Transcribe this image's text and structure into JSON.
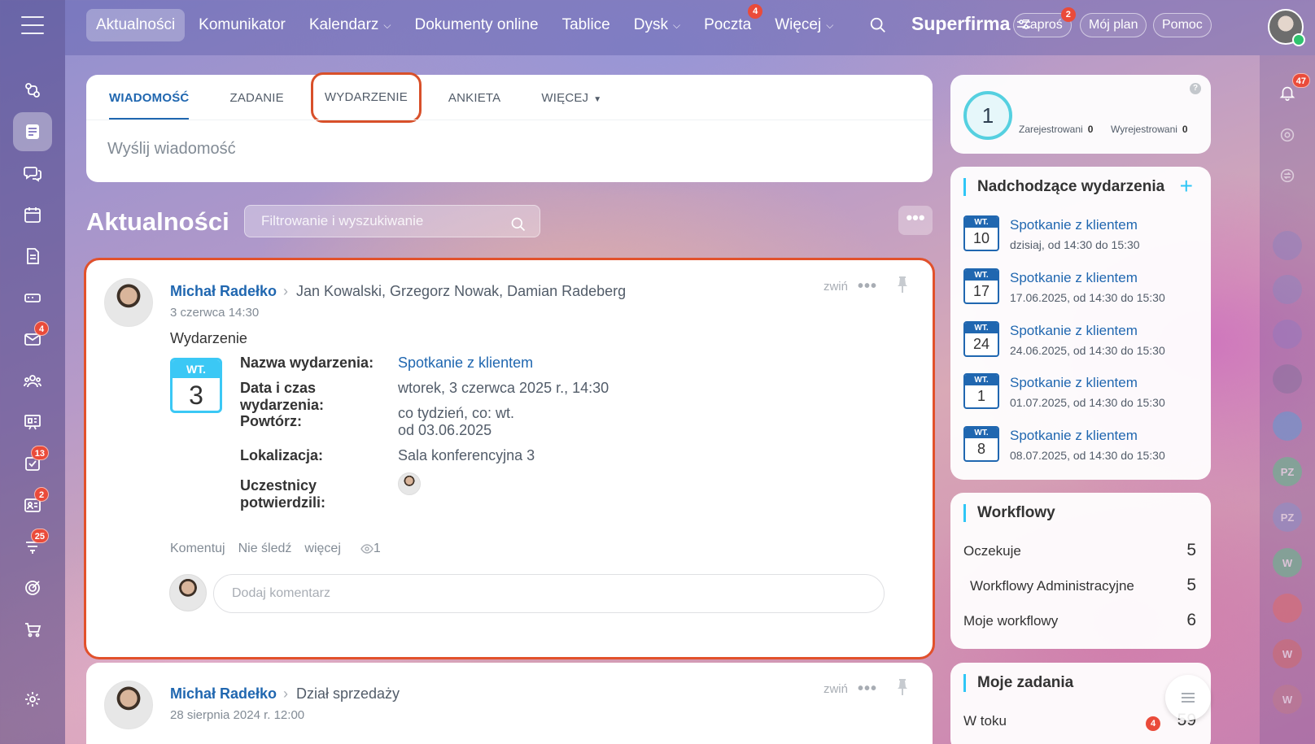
{
  "topnav": {
    "items": [
      {
        "label": "Aktualności",
        "active": true
      },
      {
        "label": "Komunikator"
      },
      {
        "label": "Kalendarz",
        "caret": "⌵"
      },
      {
        "label": "Dokumenty online"
      },
      {
        "label": "Tablice"
      },
      {
        "label": "Dysk",
        "caret": "⌵"
      },
      {
        "label": "Poczta",
        "badge": "4"
      },
      {
        "label": "Więcej",
        "caret": "⌵"
      }
    ],
    "brand": "Superfirma",
    "invite": {
      "label": "Zaproś",
      "badge": "2"
    },
    "plan": "Mój plan",
    "help": "Pomoc"
  },
  "sidebar": {
    "badges": {
      "mail": "4",
      "tasks": "13",
      "crm": "2",
      "feed": "25"
    }
  },
  "rail": {
    "notifications_badge": "47",
    "initials": [
      "PZ",
      "PZ",
      "W",
      "W",
      "W"
    ]
  },
  "composer": {
    "tabs": [
      "Wiadomość",
      "Zadanie",
      "Wydarzenie",
      "Ankieta",
      "Więcej"
    ],
    "placeholder": "Wyślij wiadomość"
  },
  "feed": {
    "title": "Aktualności",
    "filter_placeholder": "Filtrowanie i wyszukiwanie",
    "more": "•••"
  },
  "post": {
    "author": "Michał Radełko",
    "recipients": "Jan Kowalski, Grzegorz Nowak, Damian Radeberg",
    "date": "3 czerwca 14:30",
    "collapse": "zwiń",
    "dots": "•••",
    "type": "Wydarzenie",
    "calendar": {
      "day": "WT.",
      "num": "3"
    },
    "fields": {
      "name_label": "Nazwa wydarzenia:",
      "name_value": "Spotkanie z klientem",
      "datetime_label": "Data i czas wydarzenia:",
      "datetime_value": "wtorek, 3 czerwca 2025 r., 14:30",
      "repeat_label": "Powtórz:",
      "repeat_value_1": "co tydzień, co: wt.",
      "repeat_value_2": "od 03.06.2025",
      "location_label": "Lokalizacja:",
      "location_value": "Sala konferencyjna 3",
      "confirmed_label": "Uczestnicy potwierdzili:"
    },
    "footer": {
      "comment": "Komentuj",
      "unfollow": "Nie śledź",
      "more": "więcej",
      "views": "1"
    },
    "comment_placeholder": "Dodaj komentarz"
  },
  "post2": {
    "author": "Michał Radełko",
    "recipients": "Dział sprzedaży",
    "date": "28 sierpnia 2024 r. 12:00",
    "collapse": "zwiń",
    "dots": "•••"
  },
  "stats_widget": {
    "count": "1",
    "registered_label": "Zarejestrowani",
    "registered_value": "0",
    "unregistered_label": "Wyrejestrowani",
    "unregistered_value": "0",
    "help": "?"
  },
  "upcoming": {
    "title": "Nadchodzące wydarzenia",
    "plus": "+",
    "events": [
      {
        "day": "WT.",
        "num": "10",
        "title": "Spotkanie z klientem",
        "time": "dzisiaj, od 14:30 do 15:30"
      },
      {
        "day": "WT.",
        "num": "17",
        "title": "Spotkanie z klientem",
        "time": "17.06.2025, od 14:30 do 15:30"
      },
      {
        "day": "WT.",
        "num": "24",
        "title": "Spotkanie z klientem",
        "time": "24.06.2025, od 14:30 do 15:30"
      },
      {
        "day": "WT.",
        "num": "1",
        "title": "Spotkanie z klientem",
        "time": "01.07.2025, od 14:30 do 15:30"
      },
      {
        "day": "WT.",
        "num": "8",
        "title": "Spotkanie z klientem",
        "time": "08.07.2025, od 14:30 do 15:30"
      }
    ]
  },
  "workflows": {
    "title": "Workflowy",
    "rows": [
      {
        "label": "Oczekuje",
        "value": "5"
      },
      {
        "label": "Workflowy Administracyjne",
        "value": "5"
      },
      {
        "label": "Moje workflowy",
        "value": "6"
      }
    ]
  },
  "my_tasks": {
    "title": "Moje zadania",
    "row_label": "W toku",
    "row_badge": "4",
    "row_value": "59"
  }
}
